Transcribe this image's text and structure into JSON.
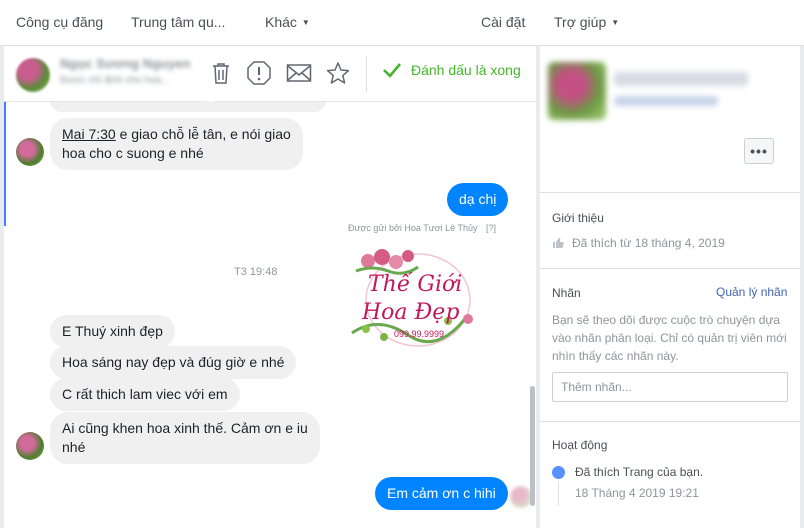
{
  "topnav": {
    "items": [
      "Công cụ đăng",
      "Trung tâm qu...",
      "Khác",
      "Cài đặt",
      "Trợ giúp"
    ]
  },
  "conversation": {
    "header": {
      "contact_name": "Ngọc Sương Nguyen",
      "contact_sub": "Được chỉ định cho hoa...",
      "mark_done_label": "Đánh dấu là xong"
    },
    "messages": {
      "m1_underlined": "Mai 7:30",
      "m1_rest_line1": " e giao chỗ lễ tân, e nói giao",
      "m1_line2": "hoa cho c suong e nhé",
      "m2": "dạ chị",
      "sent_by": "Được gửi bởi Hoa Tươi Lê Thủy",
      "sent_by_help": "[?]",
      "timestamp": "T3 19:48",
      "m3": "E Thuý xinh đẹp",
      "m4": "Hoa sáng nay đẹp và đúg giờ e nhé",
      "m5": "C rất thich lam viec với em",
      "m6_line1": "Ai cũng khen hoa xinh thế. Cảm ơn e iu",
      "m6_line2": "nhé",
      "m7": "Em cảm ơn c hihi"
    },
    "watermark": {
      "line1": "Thế Giới",
      "line2": "Hoa Đẹp",
      "phone": "099.99.9999"
    }
  },
  "sidebar": {
    "intro_title": "Giới thiệu",
    "liked_since": "Đã thích từ 18 tháng 4, 2019",
    "labels_title": "Nhãn",
    "manage_labels": "Quản lý nhãn",
    "labels_desc": "Bạn sẽ theo dõi được cuộc trò chuyện dựa vào nhãn phân loại. Chỉ có quản trị viên mới nhìn thấy các nhãn này.",
    "label_placeholder": "Thêm nhãn...",
    "more_label": "•••",
    "activity_title": "Hoạt động",
    "activity_text": "Đã thích Trang của bạn.",
    "activity_date": "18 Tháng 4 2019 19:21"
  },
  "colors": {
    "accent_blue": "#0084ff",
    "done_green": "#42b72a",
    "link_blue": "#4267b2"
  },
  "icons": [
    "trash-icon",
    "spam-icon",
    "mail-icon",
    "star-icon",
    "check-icon",
    "thumbs-up-icon"
  ]
}
